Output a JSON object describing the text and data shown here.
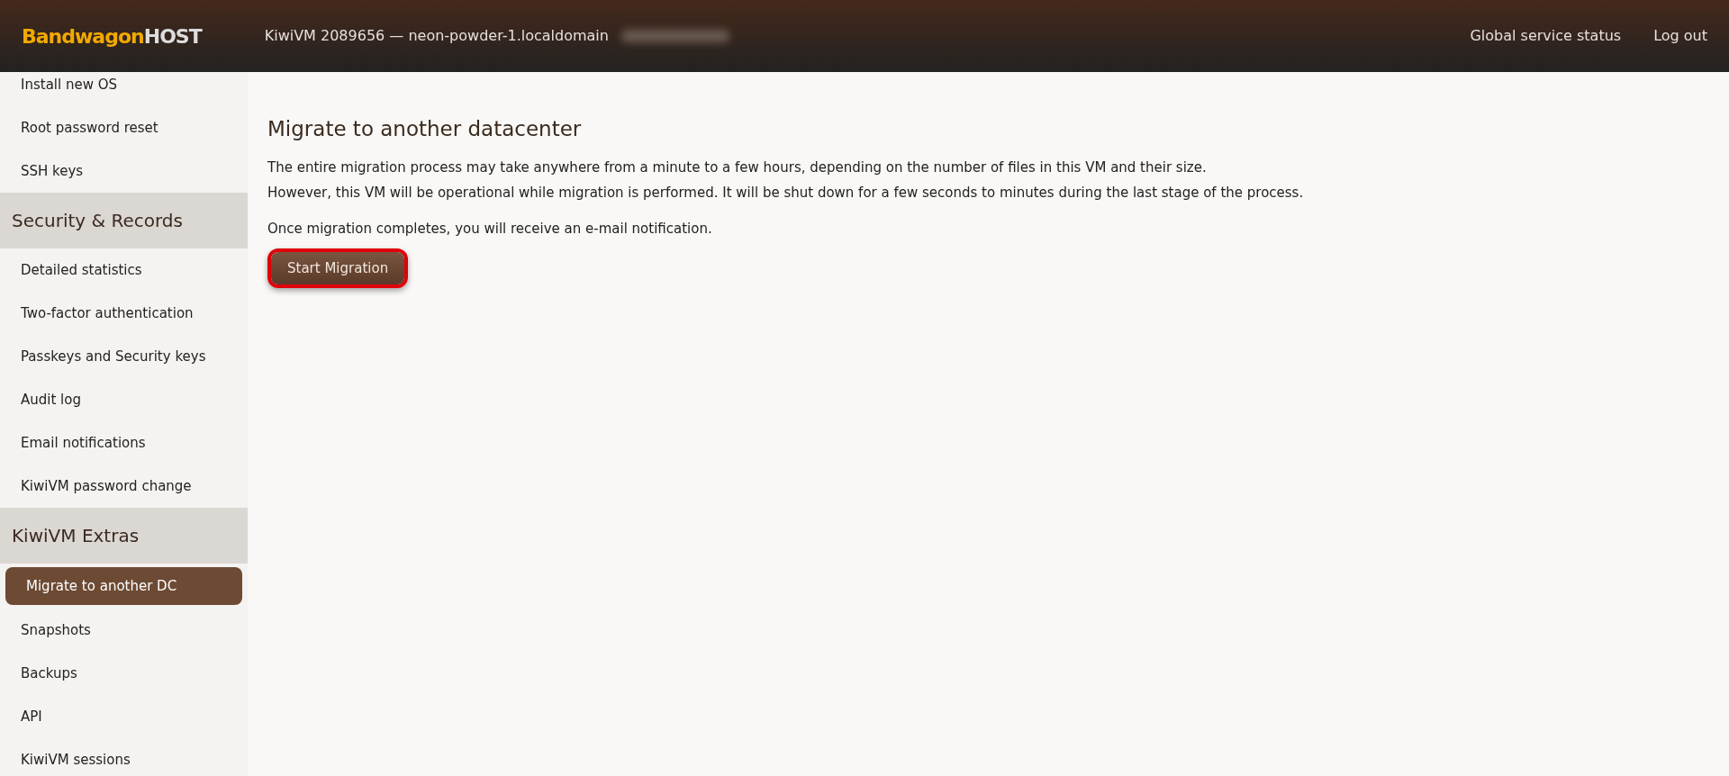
{
  "header": {
    "logo": {
      "brand": "Bandwagon",
      "suffix": "HOST"
    },
    "vm_title": "KiwiVM 2089656 — neon-powder-1.localdomain",
    "links": [
      "Global service status",
      "Log out"
    ]
  },
  "sidebar": {
    "groups": [
      {
        "items": [
          {
            "label": "Install new OS",
            "selected": false
          },
          {
            "label": "Root password reset",
            "selected": false
          },
          {
            "label": "SSH keys",
            "selected": false
          }
        ]
      },
      {
        "title": "Security & Records",
        "items": [
          {
            "label": "Detailed statistics",
            "selected": false
          },
          {
            "label": "Two-factor authentication",
            "selected": false
          },
          {
            "label": "Passkeys and Security keys",
            "selected": false
          },
          {
            "label": "Audit log",
            "selected": false
          },
          {
            "label": "Email notifications",
            "selected": false
          },
          {
            "label": "KiwiVM password change",
            "selected": false
          }
        ]
      },
      {
        "title": "KiwiVM Extras",
        "items": [
          {
            "label": "Migrate to another DC",
            "selected": true
          },
          {
            "label": "Snapshots",
            "selected": false
          },
          {
            "label": "Backups",
            "selected": false
          },
          {
            "label": "API",
            "selected": false
          },
          {
            "label": "KiwiVM sessions",
            "selected": false
          }
        ]
      }
    ]
  },
  "main": {
    "title": "Migrate to another datacenter",
    "paragraphs": [
      [
        "The entire migration process may take anywhere from a minute to a few hours, depending on the number of files in this VM and their size.",
        "However, this VM will be operational while migration is performed. It will be shut down for a few seconds to minutes during the last stage of the process."
      ],
      [
        "Once migration completes, you will receive an e-mail notification."
      ]
    ],
    "button": {
      "label": "Start Migration",
      "highlighted": true
    }
  }
}
